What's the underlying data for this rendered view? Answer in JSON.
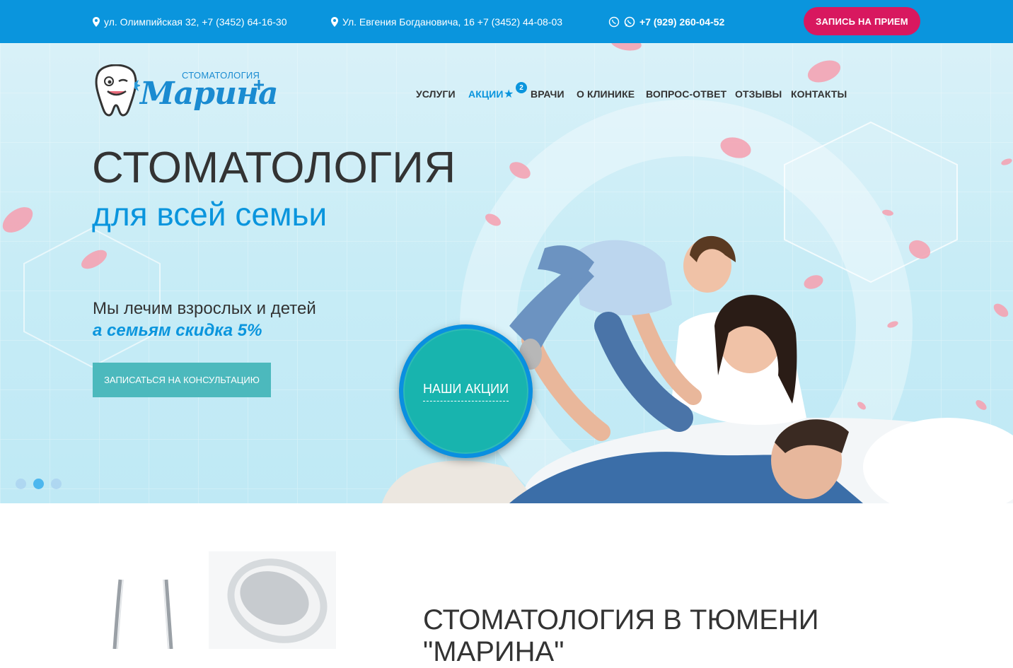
{
  "topbar": {
    "address1": "ул. Олимпийская 32, +7 (3452) 64-16-30",
    "address2": "Ул. Евгения Богдановича, 16 +7 (3452) 44-08-03",
    "phone": "+7 (929) 260-04-52",
    "cta": "ЗАПИСЬ НА ПРИЕМ"
  },
  "logo": {
    "subtitle": "СТОМАТОЛОГИЯ",
    "name": "Марина"
  },
  "nav": {
    "items": [
      "УСЛУГИ",
      "АКЦИИ",
      "ВРАЧИ",
      "О КЛИНИКЕ",
      "ВОПРОС-ОТВЕТ",
      "ОТЗЫВЫ",
      "КОНТАКТЫ"
    ],
    "badge": "2"
  },
  "hero": {
    "title": "СТОМАТОЛОГИЯ",
    "subtitle": "для всей семьи",
    "text1": "Мы лечим взрослых и детей",
    "text2": "а семьям скидка 5%",
    "button": "ЗАПИСАТЬСЯ НА КОНСУЛЬТАЦИЮ",
    "promo": "НАШИ АКЦИИ",
    "slides": 3,
    "active_slide": 2
  },
  "section": {
    "title_line1": "СТОМАТОЛОГИЯ В ТЮМЕНИ",
    "title_line2": "\"МАРИНА\""
  },
  "colors": {
    "topbar": "#0a95dd",
    "cta": "#d8185f",
    "accent": "#0a95dd",
    "button": "#4cb9bd",
    "promo": "#18b4ae"
  }
}
